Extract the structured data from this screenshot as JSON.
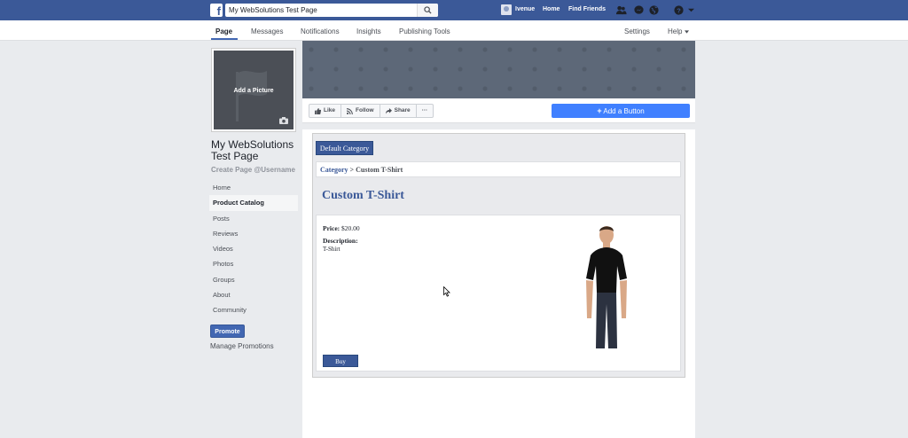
{
  "topbar": {
    "search_value": "My WebSolutions Test Page",
    "user_name": "Ivenue",
    "links": [
      "Home",
      "Find Friends"
    ],
    "icons": [
      "friends-icon",
      "messenger-icon",
      "globe-icon",
      "help-icon",
      "dropdown-icon"
    ],
    "brand_color": "#3b5998"
  },
  "subnav": {
    "tabs": [
      {
        "label": "Page",
        "active": true
      },
      {
        "label": "Messages"
      },
      {
        "label": "Notifications"
      },
      {
        "label": "Insights"
      },
      {
        "label": "Publishing Tools"
      }
    ],
    "settings": "Settings",
    "help": "Help"
  },
  "profile": {
    "add_picture": "Add a Picture",
    "page_name": "My WebSolutions Test Page",
    "create_username": "Create Page @Username"
  },
  "sidebar": {
    "items": [
      {
        "label": "Home"
      },
      {
        "label": "Product Catalog",
        "active": true
      },
      {
        "label": "Posts"
      },
      {
        "label": "Reviews"
      },
      {
        "label": "Videos"
      },
      {
        "label": "Photos"
      },
      {
        "label": "Groups"
      },
      {
        "label": "About"
      },
      {
        "label": "Community"
      }
    ],
    "promote": "Promote",
    "manage_promotions": "Manage Promotions"
  },
  "actions": {
    "like": "Like",
    "follow": "Follow",
    "share": "Share",
    "more": "···",
    "add_button": "Add a Button",
    "add_button_color": "#4080ff"
  },
  "catalog": {
    "category_button": "Default Category",
    "breadcrumb_link": "Category",
    "breadcrumb_sep": " > ",
    "breadcrumb_current": "Custom T-Shirt",
    "product_title": "Custom T-Shirt",
    "price_label": "Price:",
    "price_value": "$20.00",
    "description_label": "Description:",
    "description_value": "T-Shirt",
    "buy": "Buy"
  }
}
